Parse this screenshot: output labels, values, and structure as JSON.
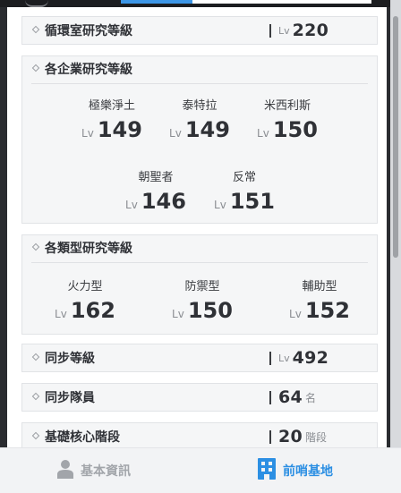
{
  "rows": {
    "circulation": {
      "label": "循環室研究等級",
      "lv": "Lv",
      "value": "220"
    },
    "sync_level": {
      "label": "同步等級",
      "lv": "Lv",
      "value": "492"
    },
    "sync_members": {
      "label": "同步隊員",
      "value": "64",
      "unit": "名"
    },
    "core_stage": {
      "label": "基礎核心階段",
      "value": "20",
      "unit": "階段"
    }
  },
  "companies": {
    "title": "各企業研究等級",
    "items": [
      {
        "name": "極樂淨土",
        "lv": "Lv",
        "value": "149"
      },
      {
        "name": "泰特拉",
        "lv": "Lv",
        "value": "149"
      },
      {
        "name": "米西利斯",
        "lv": "Lv",
        "value": "150"
      },
      {
        "name": "朝聖者",
        "lv": "Lv",
        "value": "146"
      },
      {
        "name": "反常",
        "lv": "Lv",
        "value": "151"
      }
    ]
  },
  "types": {
    "title": "各類型研究等級",
    "items": [
      {
        "name": "火力型",
        "lv": "Lv",
        "value": "162"
      },
      {
        "name": "防禦型",
        "lv": "Lv",
        "value": "150"
      },
      {
        "name": "輔助型",
        "lv": "Lv",
        "value": "152"
      }
    ]
  },
  "nav": {
    "basic": {
      "label": "基本資訊",
      "icon": "person-icon"
    },
    "base": {
      "label": "前哨基地",
      "icon": "building-icon"
    }
  },
  "colors": {
    "accent": "#2c8fe3",
    "inactive": "#a2a5aa"
  }
}
